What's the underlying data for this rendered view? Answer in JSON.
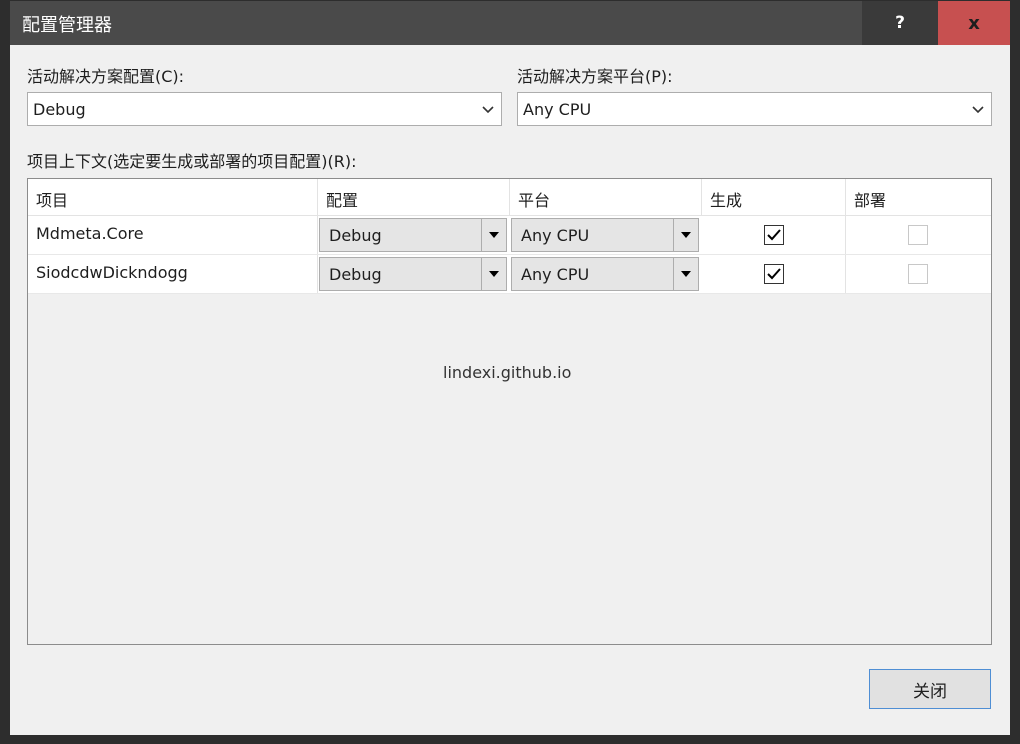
{
  "window": {
    "title": "配置管理器",
    "help_label": "?",
    "close_label": "x"
  },
  "solution_config": {
    "label": "活动解决方案配置(C):",
    "value": "Debug"
  },
  "solution_platform": {
    "label": "活动解决方案平台(P):",
    "value": "Any CPU"
  },
  "project_context": {
    "label": "项目上下文(选定要生成或部署的项目配置)(R):",
    "columns": [
      "项目",
      "配置",
      "平台",
      "生成",
      "部署"
    ],
    "rows": [
      {
        "project": "Mdmeta.Core",
        "config": "Debug",
        "platform": "Any CPU",
        "build": true,
        "deploy": false
      },
      {
        "project": "SiodcdwDickndogg",
        "config": "Debug",
        "platform": "Any CPU",
        "build": true,
        "deploy": false
      }
    ]
  },
  "watermark": "lindexi.github.io",
  "buttons": {
    "close": "关闭"
  }
}
